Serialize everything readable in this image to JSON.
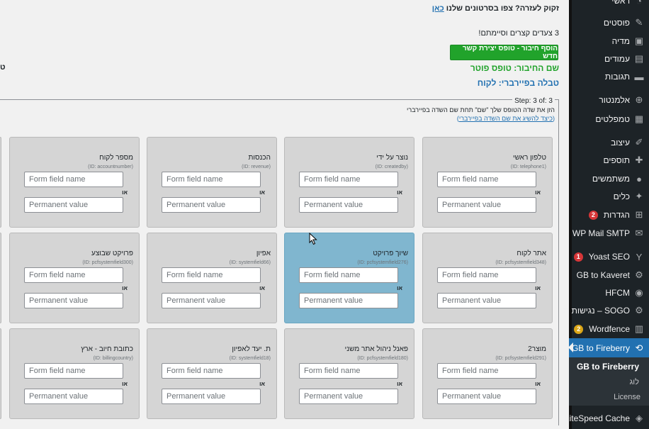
{
  "main": {
    "help_text": "זקוק לעזרה? צפו בסרטונים שלנו",
    "help_link": "כאן",
    "steps_text": "3 צעדים קצרים וסיימתם!",
    "add_button": "הוסף חיבור - טופס יצירת קשר חדש",
    "connection_name": "שם החיבור: טופס פוטר",
    "fireberry_table": "טבלה בפיירברי: לקוח",
    "left_fragment": "ט",
    "step_label": "Step: 3 of: 3",
    "instruction": "הזן את שדה הטופס שלך \"שם\" תחת שם השדה בפיירברי",
    "instruction_link_open": "(",
    "instruction_link": "כיצד להשיג את שם השדה בפיירברי",
    "instruction_link_close": ")"
  },
  "card_common": {
    "form_field_placeholder": "Form field name",
    "permanent_placeholder": "Permanent value",
    "or_label": "או"
  },
  "cards": [
    {
      "name": "טלפון ראשי",
      "id": "(ID: telephone1)"
    },
    {
      "name": "נוצר על ידי",
      "id": "(ID: createdby)"
    },
    {
      "name": "הכנסות",
      "id": "(ID: revenue)"
    },
    {
      "name": "מספר לקוח",
      "id": "(ID: accountnumber)"
    },
    {
      "name": "אתר לקוח",
      "id": "(ID: pcfsystemfield348)"
    },
    {
      "name": "שיוך פרויקט",
      "id": "(ID: pcfsystemfield276)"
    },
    {
      "name": "אפיון",
      "id": "(ID: systemfield66)"
    },
    {
      "name": "פרויקט שבוצע",
      "id": "(ID: pcfsystemfield300)"
    },
    {
      "name": "מוצר2",
      "id": "(ID: pcfsystemfield291)"
    },
    {
      "name": "פאנל ניהול אתר משני",
      "id": "(ID: pcfsystemfield180)"
    },
    {
      "name": "ת. יעד לאפיון",
      "id": "(ID: systemfield18)"
    },
    {
      "name": "כתובת חיוב - ארץ",
      "id": "(ID: billingcountry)"
    }
  ],
  "sidebar": {
    "items": [
      {
        "label": "פוסטים",
        "icon": "pin-icon"
      },
      {
        "label": "מדיה",
        "icon": "media-icon"
      },
      {
        "label": "עמודים",
        "icon": "pages-icon"
      },
      {
        "label": "תגובות",
        "icon": "comments-icon"
      },
      {
        "label": "אלמנטור",
        "icon": "elementor-icon"
      },
      {
        "label": "טמפלטים",
        "icon": "templates-icon"
      },
      {
        "label": "עיצוב",
        "icon": "brush-icon"
      },
      {
        "label": "תוספים",
        "icon": "plugin-icon"
      },
      {
        "label": "משתמשים",
        "icon": "users-icon"
      },
      {
        "label": "כלים",
        "icon": "wrench-icon"
      },
      {
        "label": "הגדרות",
        "icon": "settings-icon",
        "badge": "2"
      },
      {
        "label": "WP Mail SMTP",
        "icon": "mail-icon"
      },
      {
        "label": "Yoast SEO",
        "icon": "yoast-icon",
        "badge": "1"
      },
      {
        "label": "GB to Kaveret",
        "icon": "kaveret-icon"
      },
      {
        "label": "HFCM",
        "icon": "hfcm-icon"
      },
      {
        "label": "SOGO – נגישות מ",
        "icon": "accessibility-icon"
      },
      {
        "label": "Wordfence",
        "icon": "wordfence-icon",
        "badge": "2"
      },
      {
        "label": "GB to Fireberry",
        "icon": "fireberry-icon"
      },
      {
        "label": "LiteSpeed Cache",
        "icon": "litespeed-icon"
      }
    ],
    "submenu": [
      "GB to Fireberry",
      "לוג",
      "License"
    ],
    "top_cut": "ראשי"
  },
  "colors": {
    "sidebar_bg": "#1d2327",
    "active_bg": "#2271b1",
    "green": "#21a32b",
    "link_blue": "#2271b1",
    "card_bg": "#d5d5d5",
    "card_highlight": "#80b6cf",
    "badge_red": "#d63638",
    "badge_orange": "#dba617"
  }
}
